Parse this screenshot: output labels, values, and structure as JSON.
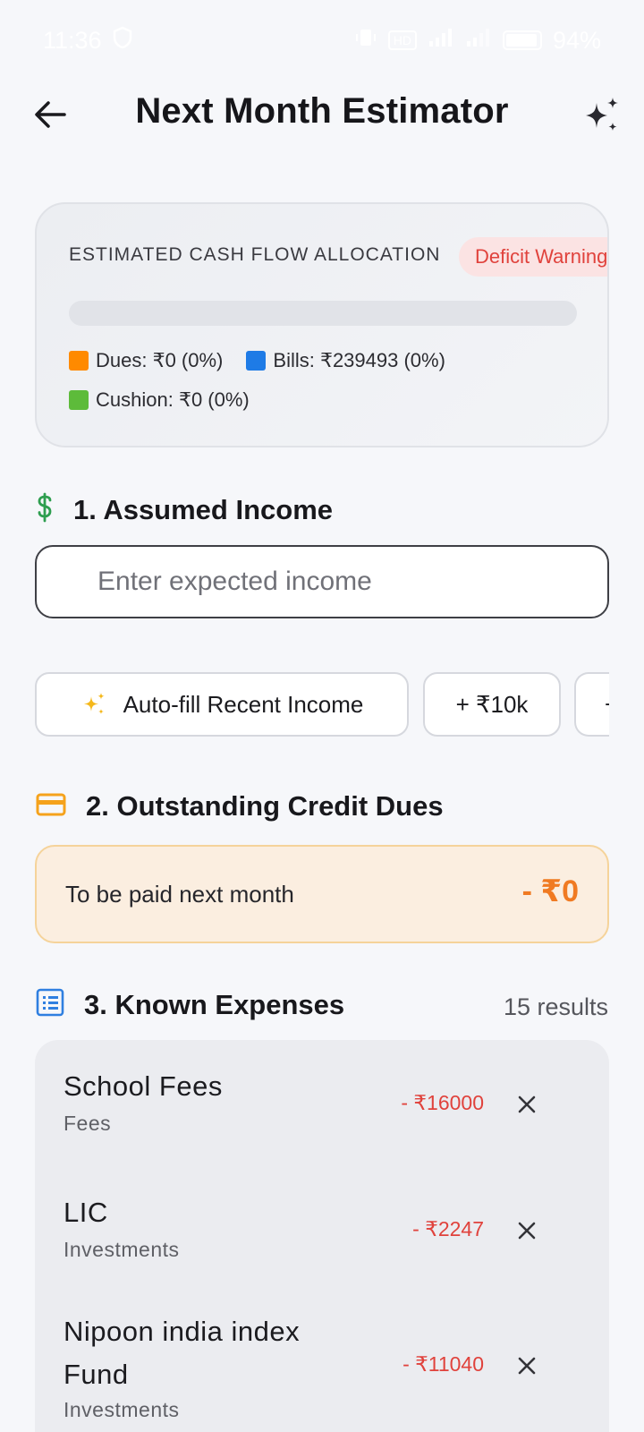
{
  "status_bar": {
    "time": "11:36",
    "battery": "94%"
  },
  "header": {
    "title": "Next Month Estimator"
  },
  "allocation": {
    "title": "ESTIMATED CASH FLOW ALLOCATION",
    "warning": "Deficit Warning ⚠️",
    "legend": {
      "dues": "Dues: ₹0 (0%)",
      "bills": "Bills: ₹239493 (0%)",
      "cushion": "Cushion: ₹0 (0%)"
    },
    "shares": {
      "dues": 0,
      "bills": 0,
      "cushion": 0
    },
    "colors": {
      "dues": "#ff8a00",
      "bills": "#1e7be6",
      "cushion": "#5dbb3a"
    }
  },
  "income": {
    "heading": "1. Assumed Income",
    "placeholder": "Enter expected income",
    "chips": {
      "autofill": "Auto-fill Recent Income",
      "plus10k": "+ ₹10k",
      "partial": "+"
    }
  },
  "dues": {
    "heading": "2. Outstanding Credit Dues",
    "label": "To be paid next month",
    "amount": "- ₹0"
  },
  "expenses": {
    "heading": "3. Known Expenses",
    "count": "15 results",
    "items": [
      {
        "name": "School Fees",
        "category": "Fees",
        "amount": "- ₹16000"
      },
      {
        "name": "LIC",
        "category": "Investments",
        "amount": "- ₹2247"
      },
      {
        "name": "Nipoon india index Fund",
        "category": "Investments",
        "amount": "- ₹11040"
      }
    ]
  },
  "colors": {
    "income_icon": "#2e9e4f",
    "dues_icon": "#f5a21b",
    "expenses_icon": "#2f7fe0",
    "negative": "#e0423c",
    "dues_amount": "#f07a22"
  }
}
